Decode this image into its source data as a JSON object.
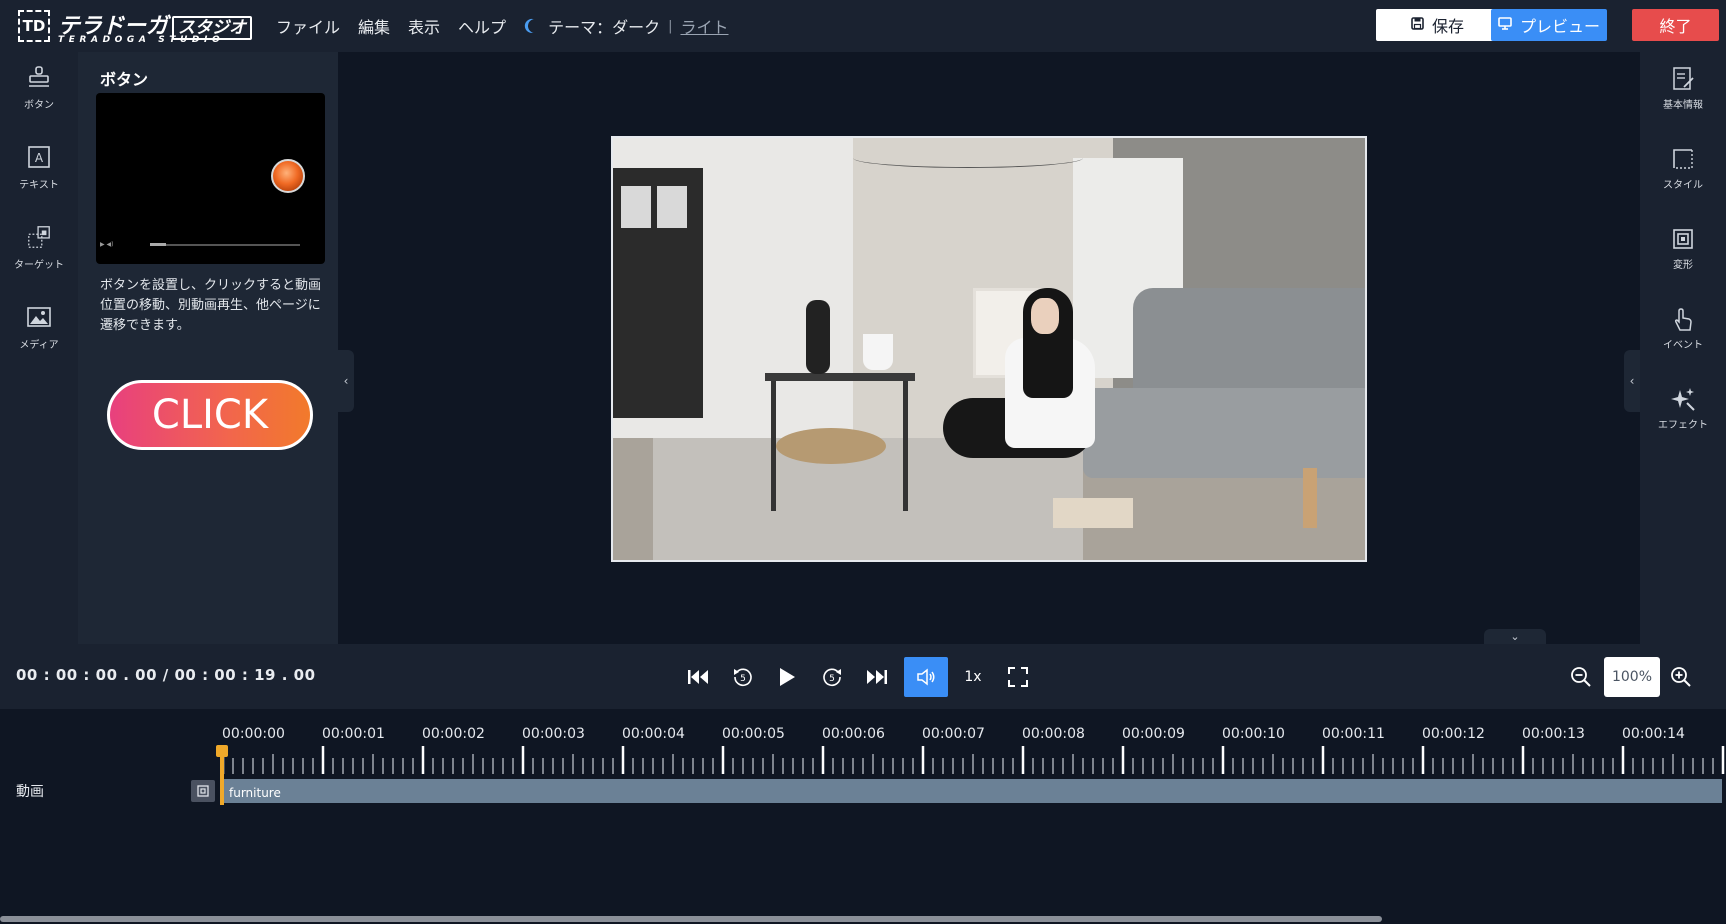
{
  "app": {
    "logo_ja": "テラドーガ",
    "logo_badge": "スタジオ",
    "logo_en": "TERADOGA STUDIO",
    "logo_mark": "TD"
  },
  "menu": {
    "items": [
      "ファイル",
      "編集",
      "表示",
      "ヘルプ"
    ],
    "theme_label": "テーマ：",
    "theme_dark": "ダーク",
    "theme_sep": "|",
    "theme_light": "ライト"
  },
  "toolbar": {
    "save_label": "保存",
    "preview_label": "プレビュー",
    "quit_label": "終了"
  },
  "left_rail": {
    "items": [
      {
        "label": "ボタン",
        "icon": "stamp-icon"
      },
      {
        "label": "テキスト",
        "icon": "text-box-icon"
      },
      {
        "label": "ターゲット",
        "icon": "target-icon"
      },
      {
        "label": "メディア",
        "icon": "image-icon"
      }
    ]
  },
  "panel": {
    "title": "ボタン",
    "description": "ボタンを設置し、クリックすると動画位置の移動、別動画再生、他ページに遷移できます。",
    "click_button_label": "CLICK"
  },
  "right_rail": {
    "items": [
      {
        "label": "基本情報",
        "icon": "edit-document-icon"
      },
      {
        "label": "スタイル",
        "icon": "style-icon"
      },
      {
        "label": "変形",
        "icon": "transform-icon"
      },
      {
        "label": "イベント",
        "icon": "pointer-hand-icon"
      },
      {
        "label": "エフェクト",
        "icon": "sparkle-icon"
      }
    ]
  },
  "controls": {
    "current_time": "00 : 00 : 00 . 00",
    "separator": "/",
    "total_time": "00 : 00 : 19 . 00",
    "speed": "1x",
    "zoom": "100%"
  },
  "timeline": {
    "ticks": [
      "00:00:00",
      "00:00:01",
      "00:00:02",
      "00:00:03",
      "00:00:04",
      "00:00:05",
      "00:00:06",
      "00:00:07",
      "00:00:08",
      "00:00:09",
      "00:00:10",
      "00:00:11",
      "00:00:12",
      "00:00:13",
      "00:00:14"
    ],
    "track_label": "動画",
    "clip_name": "furniture"
  },
  "colors": {
    "accent": "#3a8ef6",
    "danger": "#e74c4c",
    "playhead": "#f0a92a",
    "clip": "#6b8196"
  }
}
